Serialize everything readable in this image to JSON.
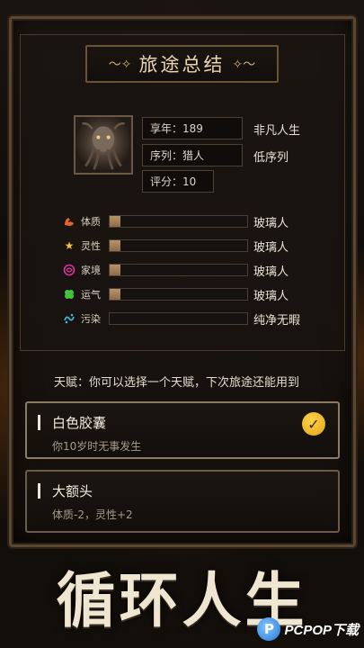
{
  "header": {
    "title": "旅途总结",
    "title_ornament_left": "〜✧",
    "title_ornament_right": "✧〜"
  },
  "summary": {
    "age_label": "享年：189",
    "age_result": "非凡人生",
    "sequence_label": "序列：猎人",
    "sequence_result": "低序列",
    "score_label": "评分：10"
  },
  "stats": [
    {
      "name": "体质",
      "icon": "muscle-icon",
      "value_text": "玻璃人",
      "fill": 0.08,
      "color": "#e0642c"
    },
    {
      "name": "灵性",
      "icon": "star-icon",
      "value_text": "玻璃人",
      "fill": 0.08,
      "color": "#f4c23a"
    },
    {
      "name": "家境",
      "icon": "coin-icon",
      "value_text": "玻璃人",
      "fill": 0.08,
      "color": "#d4379a"
    },
    {
      "name": "运气",
      "icon": "clover-icon",
      "value_text": "玻璃人",
      "fill": 0.08,
      "color": "#43c23b"
    },
    {
      "name": "污染",
      "icon": "pollution-icon",
      "value_text": "纯净无暇",
      "fill": 0,
      "color": "#3db6d6"
    }
  ],
  "talent": {
    "hint": "天赋：你可以选择一个天赋，下次旅途还能用到",
    "options": [
      {
        "title": "白色胶囊",
        "desc": "你10岁时无事发生",
        "selected": true
      },
      {
        "title": "大额头",
        "desc": "体质-2，灵性+2",
        "selected": false
      }
    ]
  },
  "banner": {
    "text": "循环人生"
  },
  "watermark": {
    "text": "PCPOP下载",
    "logo_letter": "P"
  }
}
